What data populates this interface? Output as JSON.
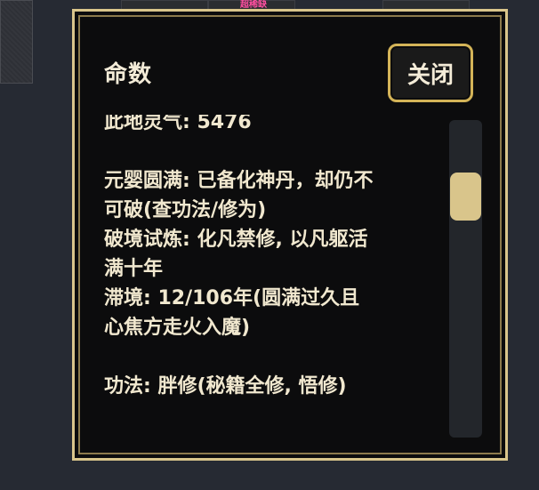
{
  "background": {
    "label": "超稀缺"
  },
  "dialog": {
    "title": "命数",
    "close_label": "关闭",
    "lines": [
      "此地灵气: 5476",
      "",
      "元婴圆满: 已备化神丹，却仍不",
      "可破(查功法/修为)",
      "破境试炼: 化凡禁修, 以凡躯活",
      "满十年",
      "滞境: 12/106年(圆满过久且",
      "心焦方走火入魔)",
      "",
      "功法: 胖修(秘籍全修, 悟修)"
    ]
  },
  "scroll": {
    "position": 0.3
  },
  "colors": {
    "border": "#d9c58b",
    "button_border": "#d4b458",
    "text": "#f1e8cf",
    "background": "#0c0c0d"
  }
}
